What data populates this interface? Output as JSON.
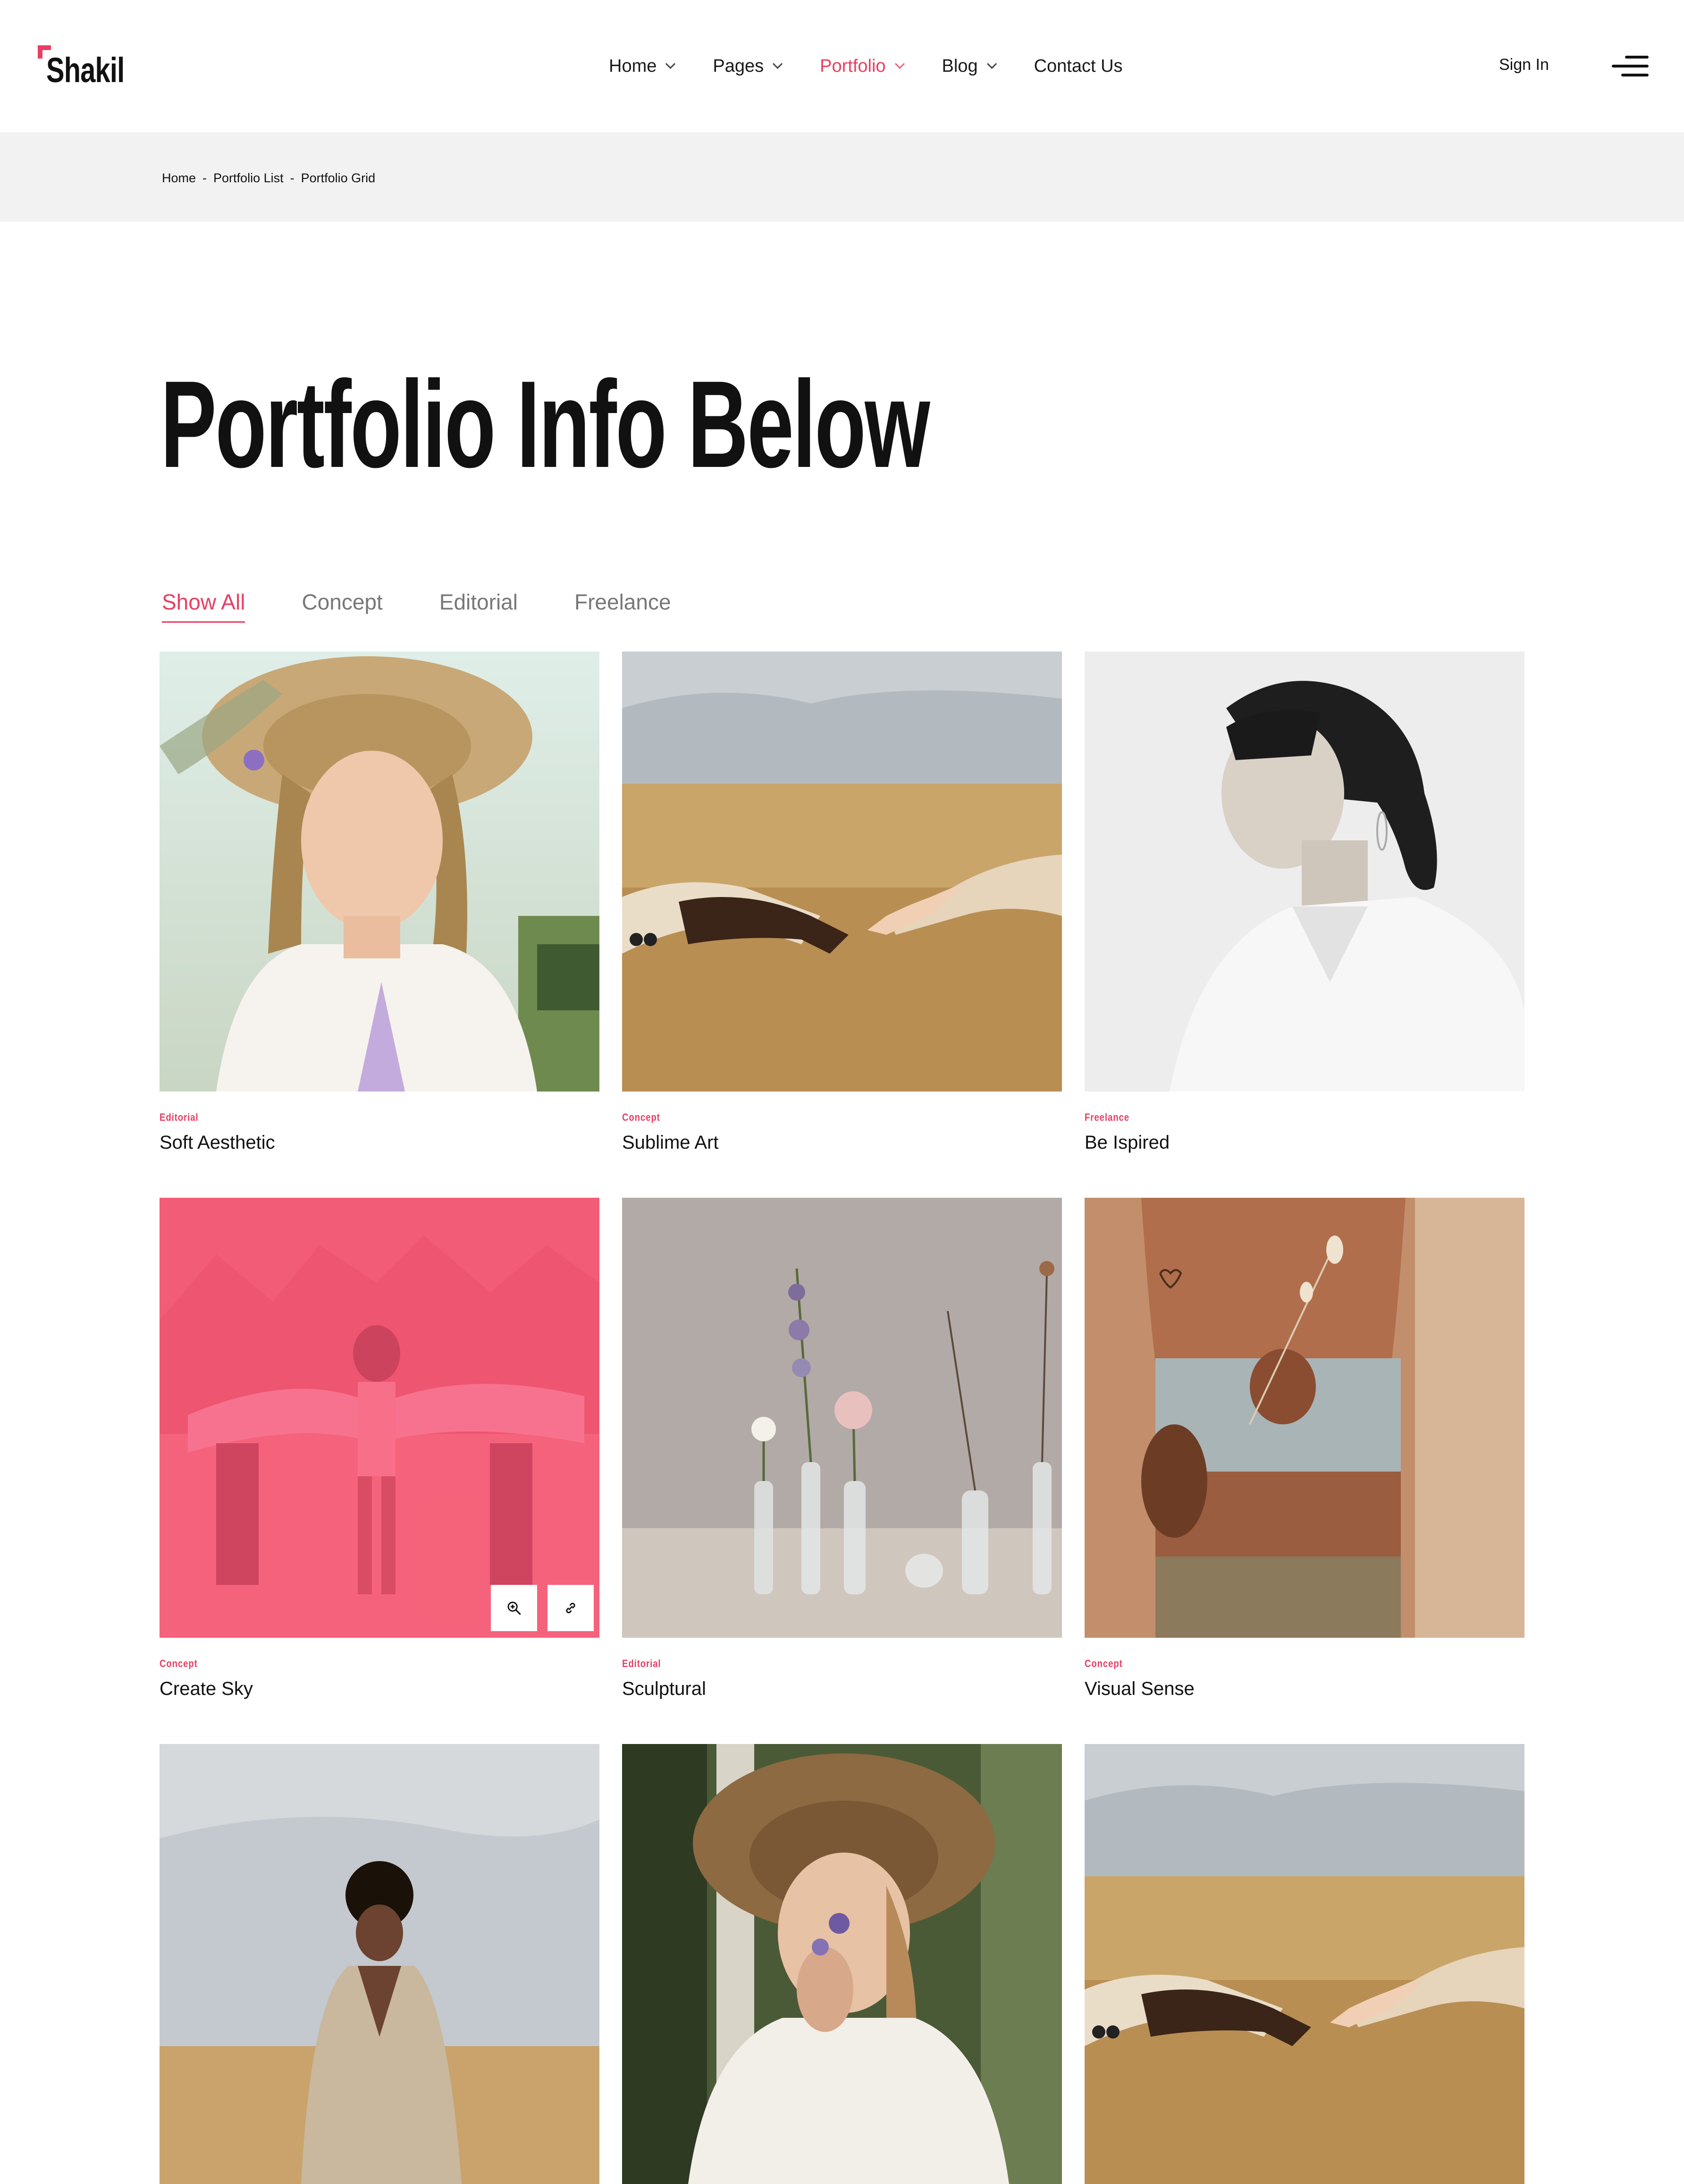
{
  "brand": {
    "name": "Shakil",
    "accent": "#e83e63"
  },
  "nav": {
    "items": [
      {
        "label": "Home",
        "has_dropdown": true,
        "active": false
      },
      {
        "label": "Pages",
        "has_dropdown": true,
        "active": false
      },
      {
        "label": "Portfolio",
        "has_dropdown": true,
        "active": true
      },
      {
        "label": "Blog",
        "has_dropdown": true,
        "active": false
      },
      {
        "label": "Contact Us",
        "has_dropdown": false,
        "active": false
      }
    ],
    "sign_in": "Sign In",
    "menu_icon": "hamburger-menu-icon"
  },
  "breadcrumb": {
    "items": [
      "Home",
      "Portfolio List",
      "Portfolio Grid"
    ],
    "separator": "-"
  },
  "page": {
    "title": "Portfolio Info Below"
  },
  "filters": {
    "items": [
      "Show All",
      "Concept",
      "Editorial",
      "Freelance"
    ],
    "active": "Show All"
  },
  "portfolio": {
    "items": [
      {
        "category": "Editorial",
        "title": "Soft Aesthetic"
      },
      {
        "category": "Concept",
        "title": "Sublime Art"
      },
      {
        "category": "Freelance",
        "title": "Be Ispired"
      },
      {
        "category": "Concept",
        "title": "Create Sky",
        "hover_overlay": true,
        "overlay_icons": [
          "zoom-in-icon",
          "link-icon"
        ]
      },
      {
        "category": "Editorial",
        "title": "Sculptural"
      },
      {
        "category": "Concept",
        "title": "Visual Sense"
      },
      {
        "category": "",
        "title": ""
      },
      {
        "category": "",
        "title": ""
      },
      {
        "category": "",
        "title": ""
      }
    ]
  }
}
